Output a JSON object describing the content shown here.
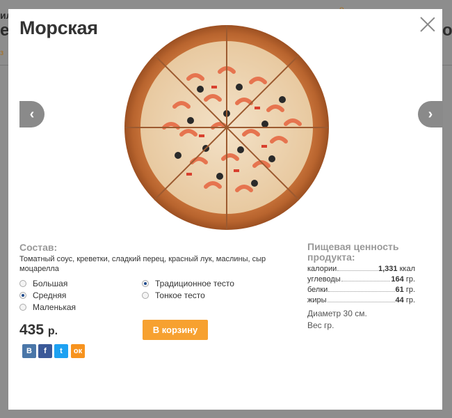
{
  "background": {
    "left_text_top": "ил",
    "left_text_big": "е",
    "left_link": "з",
    "right_link": "о",
    "right_text": "о-"
  },
  "modal": {
    "title": "Морская",
    "nav_prev": "‹",
    "nav_next": "›"
  },
  "composition": {
    "label": "Состав:",
    "text": "Томатный соус, креветки, сладкий перец, красный лук, маслины, сыр моцарелла"
  },
  "sizes": [
    {
      "label": "Большая",
      "checked": false
    },
    {
      "label": "Средняя",
      "checked": true
    },
    {
      "label": "Маленькая",
      "checked": false
    }
  ],
  "dough": [
    {
      "label": "Традиционное тесто",
      "checked": true
    },
    {
      "label": "Тонкое тесто",
      "checked": false
    }
  ],
  "price": {
    "value": "435",
    "currency": "р."
  },
  "cart_button": "В корзину",
  "social": {
    "vk": "В",
    "fb": "f",
    "tw": "t",
    "ok": "ок"
  },
  "nutrition": {
    "label": "Пищевая ценность продукта:",
    "rows": [
      {
        "name": "калории",
        "value": "1,331",
        "unit": "ккал"
      },
      {
        "name": "углеводы",
        "value": "164",
        "unit": "гр."
      },
      {
        "name": "белки",
        "value": "61",
        "unit": "гр."
      },
      {
        "name": "жиры",
        "value": "44",
        "unit": "гр."
      }
    ],
    "diameter": "Диаметр 30 см.",
    "weight": "Вес гр."
  },
  "colors": {
    "accent": "#f7a130",
    "label_gray": "#999999"
  }
}
